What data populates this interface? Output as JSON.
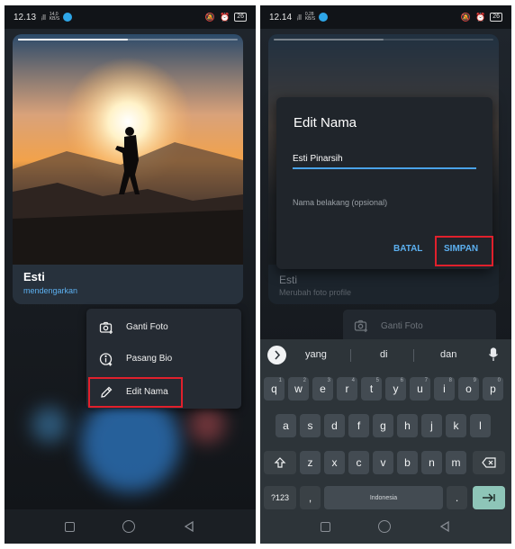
{
  "left": {
    "status": {
      "time": "12.13",
      "signal": "ᵢll",
      "speed_top": "14,0",
      "speed_bottom": "KB/S",
      "battery": "26"
    },
    "profile": {
      "name": "Esti",
      "status": "mendengarkan",
      "photo_progress": 0.5
    },
    "menu": {
      "items": [
        {
          "label": "Ganti Foto",
          "icon": "camera-add-icon"
        },
        {
          "label": "Pasang Bio",
          "icon": "info-icon"
        },
        {
          "label": "Edit Nama",
          "icon": "pencil-icon"
        }
      ]
    }
  },
  "right": {
    "status": {
      "time": "12.14",
      "signal": "ᵢll",
      "speed_top": "0,28",
      "speed_bottom": "KB/S",
      "battery": "26"
    },
    "profile_dim": {
      "name": "Esti",
      "status": "Merubah foto profile"
    },
    "menu_dim": {
      "label": "Ganti Foto"
    },
    "dialog": {
      "title": "Edit Nama",
      "first_name": "Esti Pinarsih",
      "last_name_placeholder": "Nama belakang (opsional)",
      "cancel": "BATAL",
      "save": "SIMPAN"
    },
    "keyboard": {
      "suggestions": [
        "yang",
        "di",
        "dan"
      ],
      "row1": [
        {
          "k": "q",
          "n": "1"
        },
        {
          "k": "w",
          "n": "2"
        },
        {
          "k": "e",
          "n": "3"
        },
        {
          "k": "r",
          "n": "4"
        },
        {
          "k": "t",
          "n": "5"
        },
        {
          "k": "y",
          "n": "6"
        },
        {
          "k": "u",
          "n": "7"
        },
        {
          "k": "i",
          "n": "8"
        },
        {
          "k": "o",
          "n": "9"
        },
        {
          "k": "p",
          "n": "0"
        }
      ],
      "row2": [
        "a",
        "s",
        "d",
        "f",
        "g",
        "h",
        "j",
        "k",
        "l"
      ],
      "row3": [
        "z",
        "x",
        "c",
        "v",
        "b",
        "n",
        "m"
      ],
      "symbols_key": "?123",
      "comma_key": ",",
      "space_label": "Indonesia",
      "period_key": "."
    }
  },
  "colors": {
    "accent": "#5cb0f0",
    "highlight": "#e0202c",
    "keyboard_enter": "#8ec5b8"
  }
}
